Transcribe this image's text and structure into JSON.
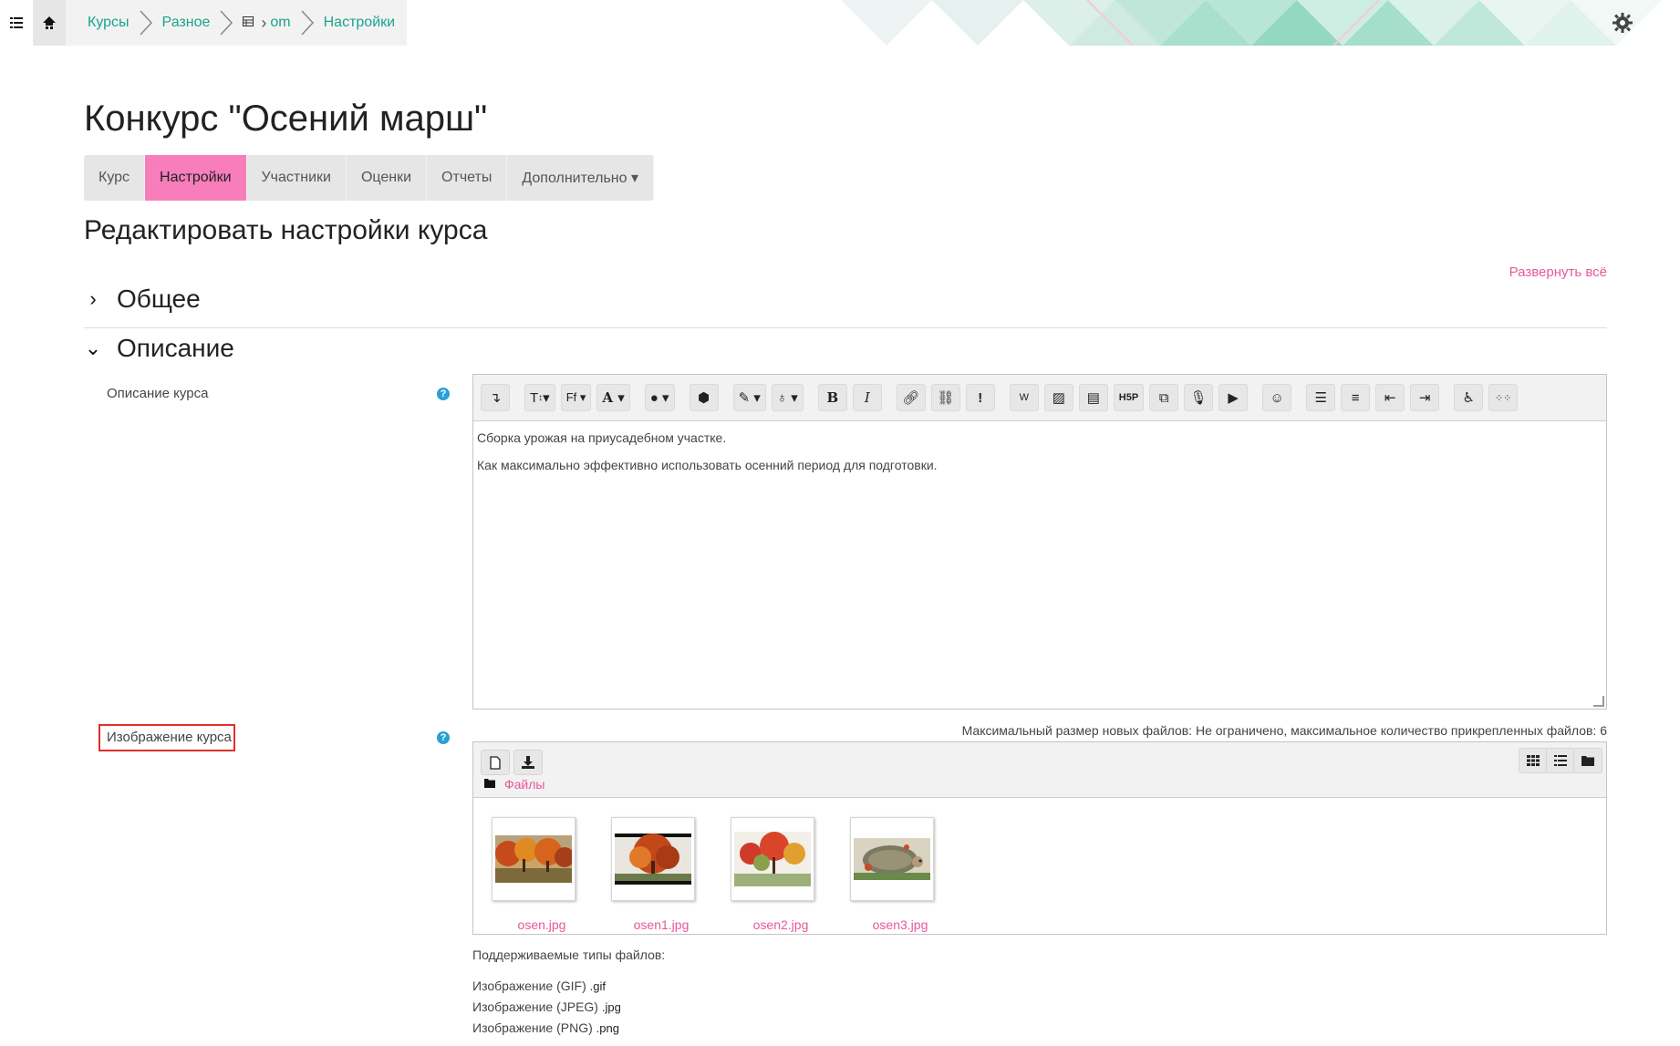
{
  "navbar": {
    "menu_icon": "list-icon",
    "home_icon": "home-icon",
    "breadcrumbs": [
      "Курсы",
      "Разное",
      "om",
      "Настройки"
    ],
    "settings_icon": "gear-icon"
  },
  "course": {
    "title": "Конкурс \"Осений марш\"",
    "tabs": [
      {
        "label": "Курс"
      },
      {
        "label": "Настройки",
        "active": true
      },
      {
        "label": "Участники"
      },
      {
        "label": "Оценки"
      },
      {
        "label": "Отчеты"
      },
      {
        "label": "Дополнительно ▾"
      }
    ]
  },
  "page": {
    "heading": "Редактировать настройки курса",
    "expand_all": "Развернуть всё",
    "section_general": "Общее",
    "section_description": "Описание"
  },
  "description_field": {
    "label": "Описание курса",
    "paragraphs": [
      "Сборка урожая на приусадебном участке.",
      "Как максимально эффективно использовать осенний период для подготовки."
    ]
  },
  "image_field": {
    "label": "Изображение курса",
    "limits": "Максимальный размер новых файлов: Не ограничено, максимальное количество прикрепленных файлов: 6",
    "path_label": "Файлы",
    "files": [
      "osen.jpg",
      "osen1.jpg",
      "osen2.jpg",
      "osen3.jpg"
    ],
    "supported_title": "Поддерживаемые типы файлов:",
    "types": [
      {
        "name": "Изображение (GIF)",
        "ext": ".gif"
      },
      {
        "name": "Изображение (JPEG)",
        "ext": ".jpg"
      },
      {
        "name": "Изображение (PNG)",
        "ext": ".png"
      }
    ]
  },
  "colors": {
    "accent_pink": "#f77dbb",
    "link_pink": "#e8579b",
    "breadcrumb_teal": "#19a48d",
    "help_blue": "#2a9fd6",
    "highlight_red": "#e0302a"
  }
}
